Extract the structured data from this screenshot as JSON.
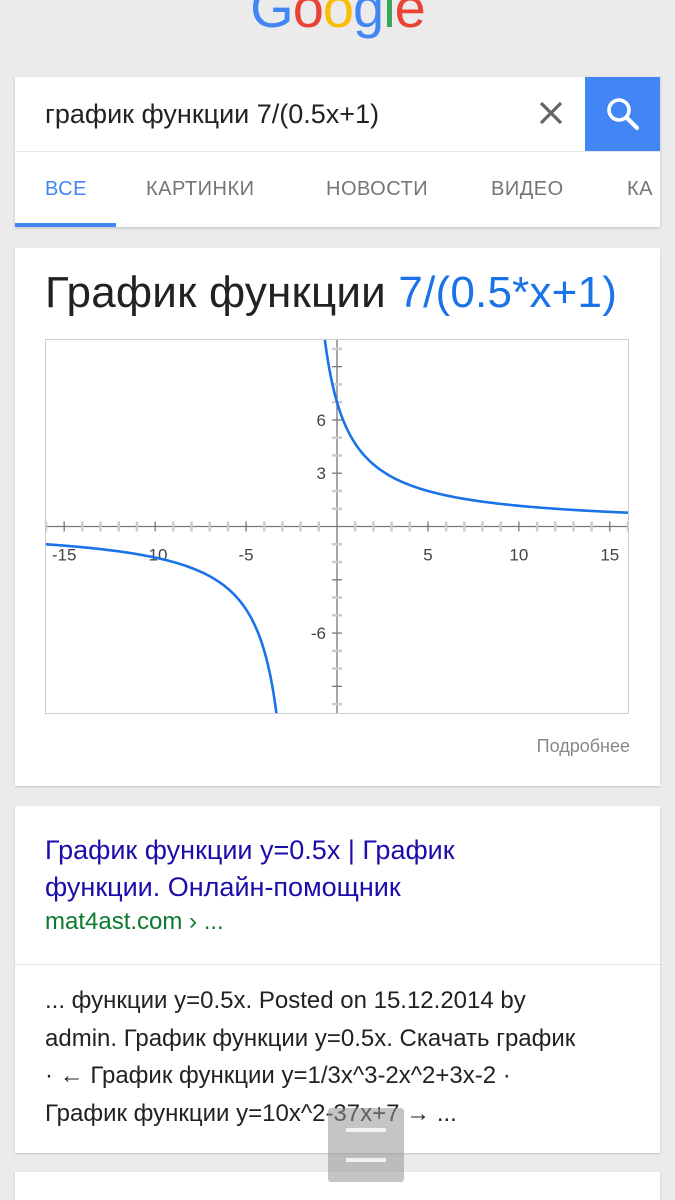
{
  "logo": {
    "letters": [
      "G",
      "o",
      "o",
      "g",
      "l",
      "e"
    ],
    "colors": [
      "#4285f4",
      "#ea4335",
      "#fbbc05",
      "#4285f4",
      "#34a853",
      "#ea4335"
    ]
  },
  "search": {
    "query": "график функции 7/(0.5x+1)",
    "clear_icon": "close-icon",
    "search_icon": "search-icon",
    "button_color": "#4285f4"
  },
  "tabs": [
    {
      "label": "ВСЕ",
      "active": true
    },
    {
      "label": "КАРТИНКИ",
      "active": false
    },
    {
      "label": "НОВОСТИ",
      "active": false
    },
    {
      "label": "ВИДЕО",
      "active": false
    },
    {
      "label": "КА",
      "active": false
    }
  ],
  "graph_card": {
    "title_prefix": "График функции",
    "title_function": "7/(0.5*x+1)",
    "more_link": "Подробнее"
  },
  "chart_data": {
    "type": "line",
    "function": "7/(0.5*x+1)",
    "title": "",
    "xlim": [
      -16,
      16
    ],
    "ylim": [
      -10.5,
      10.5
    ],
    "x_ticks": [
      -15,
      -10,
      -5,
      5,
      10,
      15
    ],
    "y_ticks": [
      6,
      3,
      -6
    ],
    "series": [
      {
        "x": [
          -16,
          -12,
          -8,
          -6,
          -5,
          -4,
          -3.5,
          -3.2
        ],
        "y": [
          -1,
          -1.4,
          -2.33,
          -3.5,
          -4.67,
          -7,
          -9.33,
          -11.67
        ]
      },
      {
        "x": [
          0,
          1,
          2,
          4,
          6,
          10,
          16
        ],
        "y": [
          7,
          4.67,
          3.5,
          2.33,
          1.75,
          1.17,
          0.78
        ]
      }
    ],
    "line_color": "#1a73e8",
    "grid": false
  },
  "result": {
    "title_line1": "График функции y=0.5x | График",
    "title_line2": "функции. Онлайн-помощник",
    "url": "mat4ast.com › ...",
    "snippet_lines": [
      "... функции y=0.5x. Posted on 15.12.2014 by",
      "admin. График функции y=0.5x. Скачать график",
      "· ← График функции y=1/3x^3-2x^2+3x-2 ·",
      "График функции y=10x^2-37x+7 →  ..."
    ]
  },
  "menu_button": {
    "icon": "menu-icon"
  }
}
